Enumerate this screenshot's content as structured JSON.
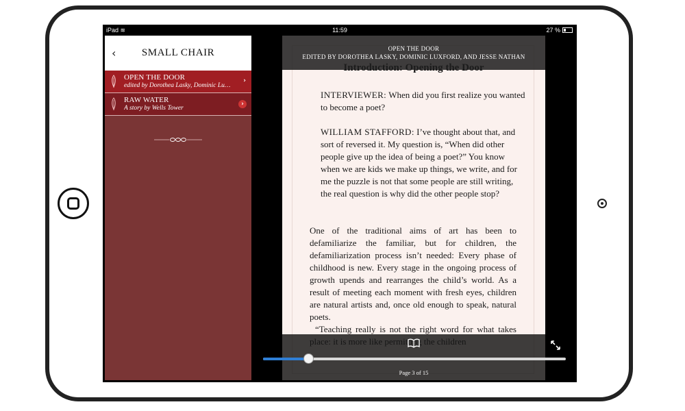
{
  "status_bar": {
    "device": "iPad",
    "time": "11:59",
    "battery": "27 %"
  },
  "sidebar": {
    "title": "SMALL CHAIR",
    "items": [
      {
        "title": "OPEN THE DOOR",
        "subtitle": "edited by Dorothea Lasky, Dominic Lu…",
        "active": true
      },
      {
        "title": "RAW WATER",
        "subtitle": "A story by Wells Tower",
        "active": false
      }
    ]
  },
  "reader": {
    "header_line1": "OPEN THE DOOR",
    "header_line2": "EDITED BY DOROTHEA LASKY, DOMINIC LUXFORD, AND JESSE NATHAN",
    "chapter_title": "Introduction: Opening the Door",
    "q1_speaker": "INTERVIEWER:",
    "q1_text": " When did you first realize you wanted to become a poet?",
    "q2_speaker": "WILLIAM STAFFORD:",
    "q2_text": " I’ve thought about that, and sort of reversed it. My question is, “When did other people give up the idea of being a poet?” You know when we are kids we make up things, we write, and for me the puzzle is not that some people are still writing, the real question is why did the other people stop?",
    "paragraph1": "One of the traditional aims of art has been to defamiliarize the familiar, but for children, the defamiliarization process isn’t needed: Every phase of childhood is new. Every stage in the ongoing process of growth upends and rearranges the child’s world. As a result of meeting each moment with fresh eyes, children are natural artists and, once old enough to speak, natural poets.",
    "paragraph2": "“Teaching really is not the right word for what takes place: it is more like permitting the children",
    "progress_fraction": 0.15,
    "page_indicator": "Page 3 of 15"
  },
  "colors": {
    "active_item": "#a11e23",
    "sidebar_bg": "#7a3535",
    "progress": "#2f7fd6"
  }
}
